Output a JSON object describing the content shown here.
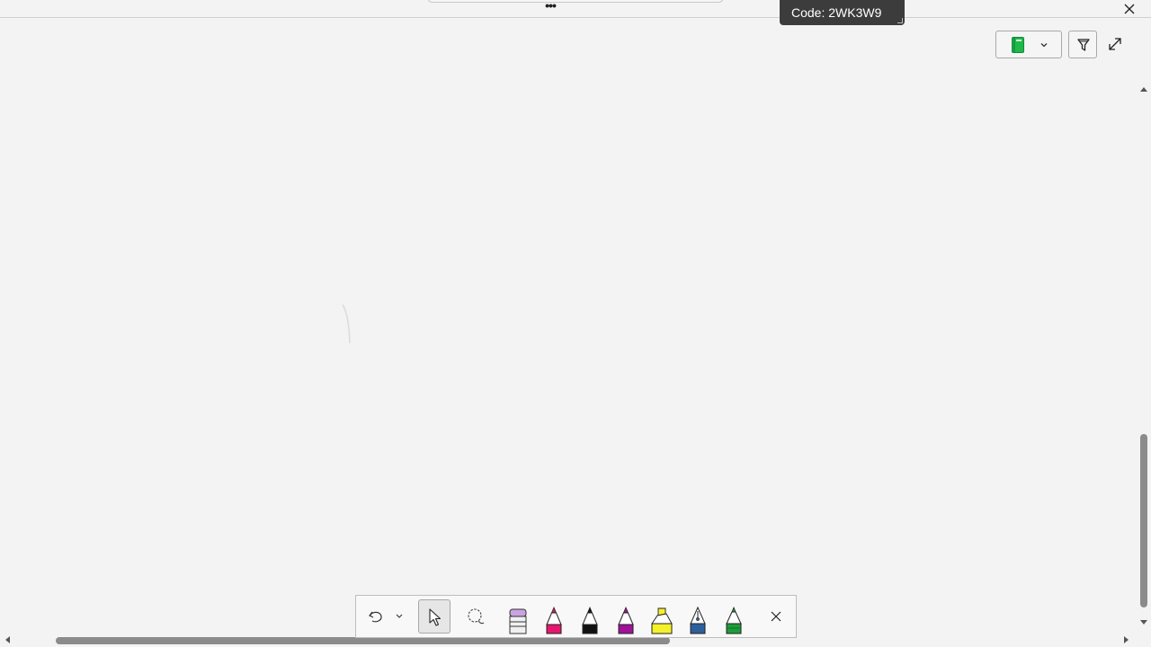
{
  "window": {
    "more_label": "•••",
    "code_label": "Code: 2WK3W9",
    "close_icon": "close-icon"
  },
  "header_controls": {
    "notebook_icon": "notebook-icon",
    "notebook_color": "#1fb84a",
    "dropdown_icon": "chevron-down-icon",
    "filter_icon": "filter-funnel-icon",
    "expand_icon": "expand-diagonal-icon"
  },
  "toolbar": {
    "tools": [
      {
        "name": "undo",
        "icon": "undo-icon"
      },
      {
        "name": "undo-dropdown",
        "icon": "chevron-down-icon"
      },
      {
        "name": "select",
        "icon": "cursor-arrow-icon",
        "selected": true
      },
      {
        "name": "lasso",
        "icon": "lasso-select-icon"
      },
      {
        "name": "eraser",
        "icon": "eraser-icon",
        "color": "#c9a3e0"
      },
      {
        "name": "pen-pink",
        "icon": "pen-icon",
        "color": "#e6176e"
      },
      {
        "name": "pen-black",
        "icon": "pen-icon",
        "color": "#111111"
      },
      {
        "name": "pen-purple",
        "icon": "pen-icon",
        "color": "#a1129a"
      },
      {
        "name": "highlighter-yellow",
        "icon": "highlighter-icon",
        "color": "#f4f12a"
      },
      {
        "name": "fountain-pen-blue",
        "icon": "fountain-pen-icon",
        "color": "#2d5f9c"
      },
      {
        "name": "pencil-green",
        "icon": "pencil-icon",
        "color": "#1f9c3a"
      },
      {
        "name": "close-toolbar",
        "icon": "close-icon"
      }
    ]
  }
}
